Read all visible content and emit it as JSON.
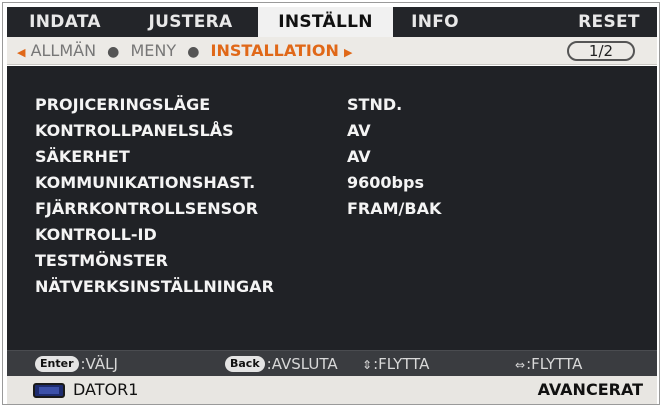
{
  "tabs": [
    {
      "label": "INDATA",
      "active": false
    },
    {
      "label": "JUSTERA",
      "active": false
    },
    {
      "label": "INSTÄLLN",
      "active": true
    },
    {
      "label": "INFO",
      "active": false
    },
    {
      "label": "RESET",
      "active": false
    }
  ],
  "breadcrumb": {
    "items": [
      "ALLMÄN",
      "MENY"
    ],
    "current": "INSTALLATION",
    "page": "1/2"
  },
  "settings": [
    {
      "label": "PROJICERINGSLÄGE",
      "value": "STND."
    },
    {
      "label": "KONTROLLPANELSLÅS",
      "value": "AV"
    },
    {
      "label": "SÄKERHET",
      "value": "AV"
    },
    {
      "label": "KOMMUNIKATIONSHAST.",
      "value": "9600bps"
    },
    {
      "label": "FJÄRRKONTROLLSENSOR",
      "value": "FRAM/BAK"
    },
    {
      "label": "KONTROLL-ID",
      "value": ""
    },
    {
      "label": "TESTMÖNSTER",
      "value": ""
    },
    {
      "label": "NÄTVERKSINSTÄLLNINGAR",
      "value": ""
    }
  ],
  "help": {
    "enter_key": "Enter",
    "enter_text": ":VÄLJ",
    "back_key": "Back",
    "back_text": ":AVSLUTA",
    "updown_text": ":FLYTTA",
    "leftright_text": ":FLYTTA"
  },
  "status": {
    "source": "DATOR1",
    "mode": "AVANCERAT"
  },
  "colors": {
    "accent": "#e06818",
    "panel": "#202226",
    "tab_bar": "#232529"
  }
}
